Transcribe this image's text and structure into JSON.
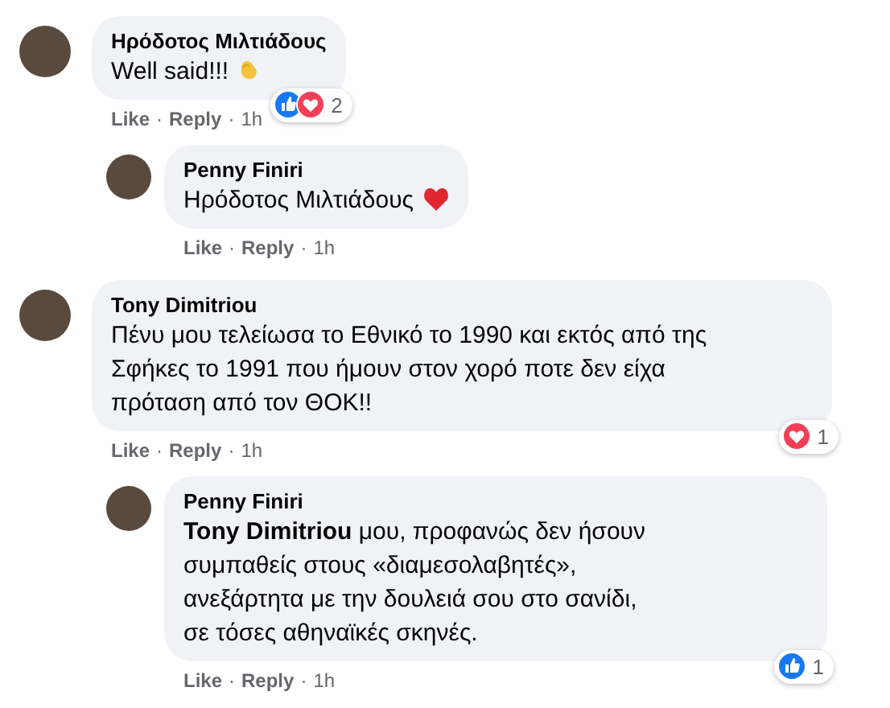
{
  "comments": [
    {
      "author": "Ηρόδοτος Μιλτιάδους",
      "body": "Well said!!!",
      "emoji": {
        "kind": "clap"
      },
      "reactions": {
        "icons": [
          {
            "kind": "like"
          },
          {
            "kind": "love"
          }
        ],
        "count": "2"
      },
      "actions": {
        "like": "Like",
        "reply": "Reply",
        "time": "1h",
        "separator": "·"
      },
      "replies": [
        {
          "author": "Penny Finiri",
          "body": "Ηρόδοτος Μιλτιάδους",
          "emoji": {
            "kind": "heart"
          },
          "actions": {
            "like": "Like",
            "reply": "Reply",
            "time": "1h",
            "separator": "·"
          }
        }
      ]
    },
    {
      "author": "Tony Dimitriou",
      "body": "Πένυ μου τελείωσα το Εθνικό το 1990 και εκτός από της Σφήκες το 1991 που ήμουν στον χορό ποτε δεν είχα πρόταση από τον ΘΟΚ!!",
      "reactions": {
        "icons": [
          {
            "kind": "love"
          }
        ],
        "count": "1"
      },
      "actions": {
        "like": "Like",
        "reply": "Reply",
        "time": "1h",
        "separator": "·"
      },
      "replies": [
        {
          "author": "Penny Finiri",
          "body": "**Tony Dimitriou** μου, προφανώς δεν ήσουν συμπαθείς στους «διαμεσολαβητές», ανεξάρτητα με την δουλειά σου στο σανίδι, σε τόσες αθηναϊκές σκηνές.",
          "reactions": {
            "icons": [
              {
                "kind": "like"
              }
            ],
            "count": "1"
          },
          "actions": {
            "like": "Like",
            "reply": "Reply",
            "time": "1h",
            "separator": "·"
          }
        }
      ]
    }
  ]
}
